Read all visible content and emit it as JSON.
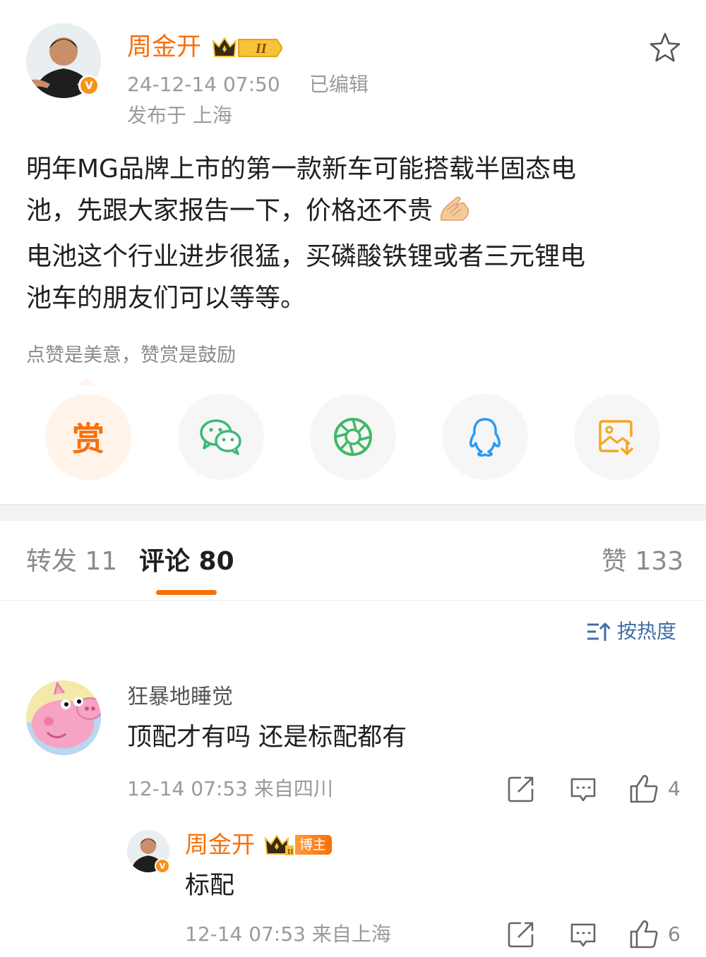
{
  "post": {
    "author": "周金开",
    "time": "24-12-14 07:50",
    "edited": "已编辑",
    "location": "发布于 上海",
    "paragraph_lines": [
      "明年MG品牌上市的第一款新车可能搭载半固态电",
      "池，先跟大家报告一下，价格还不贵",
      "电池这个行业进步很猛，买磷酸铁锂或者三元锂电",
      "池车的朋友们可以等等。"
    ],
    "reward_hint": "点赞是美意，赞赏是鼓励",
    "reward_char": "赏",
    "crown_level": "II"
  },
  "tabs": {
    "repost": "转发 11",
    "comments": "评论 80",
    "likes": "赞 133"
  },
  "sort": {
    "label": "按热度"
  },
  "comments": [
    {
      "name": "狂暴地睡觉",
      "text": "顶配才有吗 还是标配都有",
      "meta": "12-14 07:53 来自四川",
      "likes": "4"
    }
  ],
  "reply": {
    "name": "周金开",
    "badge": "博主",
    "text": "标配",
    "meta": "12-14 07:53 来自上海",
    "likes": "6"
  },
  "colors": {
    "accent": "#f7700b",
    "link_blue": "#3f6ea8",
    "wechat_green": "#3cb878",
    "moments_green": "#42b865",
    "qq_blue": "#2a9bf0",
    "save_orange": "#f5a623"
  }
}
